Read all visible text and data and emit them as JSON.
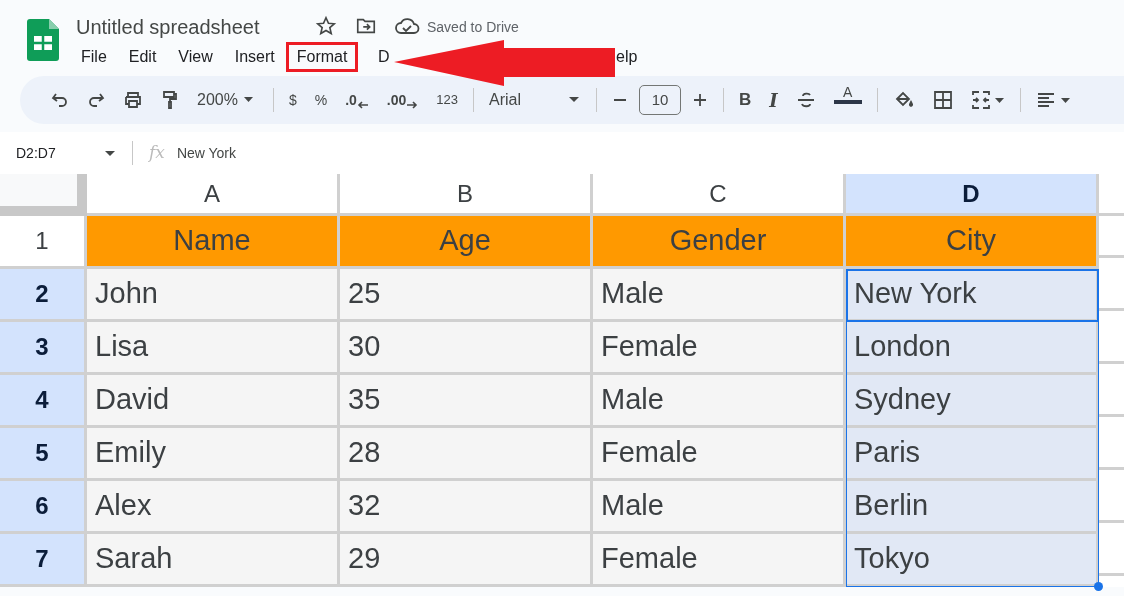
{
  "title": "Untitled spreadsheet",
  "save_status": "Saved to Drive",
  "menu": [
    {
      "label": "File",
      "boxed": false
    },
    {
      "label": "Edit",
      "boxed": false
    },
    {
      "label": "View",
      "boxed": false
    },
    {
      "label": "Insert",
      "boxed": false
    },
    {
      "label": "Format",
      "boxed": true
    },
    {
      "label": "D",
      "boxed": false
    },
    {
      "label": "elp",
      "boxed": false
    }
  ],
  "annotation": {
    "kind": "arrow",
    "color": "#ed1c24"
  },
  "toolbar": {
    "zoom": "200%",
    "currency": "$",
    "percent": "%",
    "decrease_decimals": ".0",
    "increase_decimals": ".00",
    "number_format": "123",
    "font": "Arial",
    "font_size": "10",
    "bold": "B",
    "italic": "I",
    "text_color": "A"
  },
  "formula_bar": {
    "name_box": "D2:D7",
    "fx": "fx",
    "value": "New York"
  },
  "columns": [
    {
      "label": "A",
      "selected": false
    },
    {
      "label": "B",
      "selected": false
    },
    {
      "label": "C",
      "selected": false
    },
    {
      "label": "D",
      "selected": true
    }
  ],
  "rows": [
    {
      "number": "1",
      "selected": false,
      "kind": "header",
      "cells": [
        "Name",
        "Age",
        "Gender",
        "City"
      ]
    },
    {
      "number": "2",
      "selected": true,
      "kind": "data",
      "cells": [
        "John",
        "25",
        "Male",
        "New York"
      ]
    },
    {
      "number": "3",
      "selected": true,
      "kind": "data",
      "cells": [
        "Lisa",
        "30",
        "Female",
        "London"
      ]
    },
    {
      "number": "4",
      "selected": true,
      "kind": "data",
      "cells": [
        "David",
        "35",
        "Male",
        "Sydney"
      ]
    },
    {
      "number": "5",
      "selected": true,
      "kind": "data",
      "cells": [
        "Emily",
        "28",
        "Female",
        "Paris"
      ]
    },
    {
      "number": "6",
      "selected": true,
      "kind": "data",
      "cells": [
        "Alex",
        "32",
        "Male",
        "Berlin"
      ]
    },
    {
      "number": "7",
      "selected": true,
      "kind": "data",
      "cells": [
        "Sarah",
        "29",
        "Female",
        "Tokyo"
      ]
    }
  ]
}
